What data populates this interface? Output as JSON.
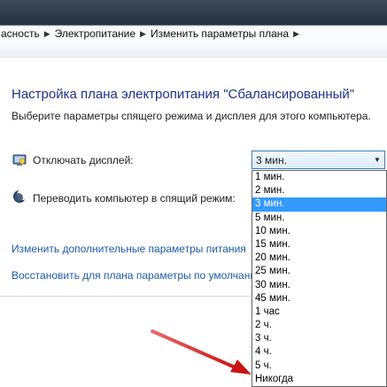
{
  "breadcrumb": {
    "items": [
      "асность",
      "Электропитание",
      "Изменить параметры плана"
    ]
  },
  "page": {
    "title": "Настройка плана электропитания \"Сбалансированный\"",
    "subtitle": "Выберите параметры спящего режима и дисплея для этого компьютера."
  },
  "display_row": {
    "icon": "monitor-icon",
    "label": "Отключать дисплей:",
    "selected": "3 мин."
  },
  "sleep_row": {
    "icon": "moon-icon",
    "label": "Переводить компьютер в спящий режим:"
  },
  "links": {
    "advanced": "Изменить дополнительные параметры питания",
    "restore": "Восстановить для плана параметры по умолчанию"
  },
  "dropdown": {
    "options": [
      "1 мин.",
      "2 мин.",
      "3 мин.",
      "5 мин.",
      "10 мин.",
      "15 мин.",
      "20 мин.",
      "25 мин.",
      "30 мин.",
      "45 мин.",
      "1 час",
      "2 ч.",
      "3 ч.",
      "4 ч.",
      "5 ч.",
      "Никогда"
    ],
    "highlighted_index": 2
  },
  "colors": {
    "title": "#1e3287",
    "link": "#1e5aa8",
    "highlight": "#3399ff",
    "annotation_arrow": "#d81e1e"
  }
}
